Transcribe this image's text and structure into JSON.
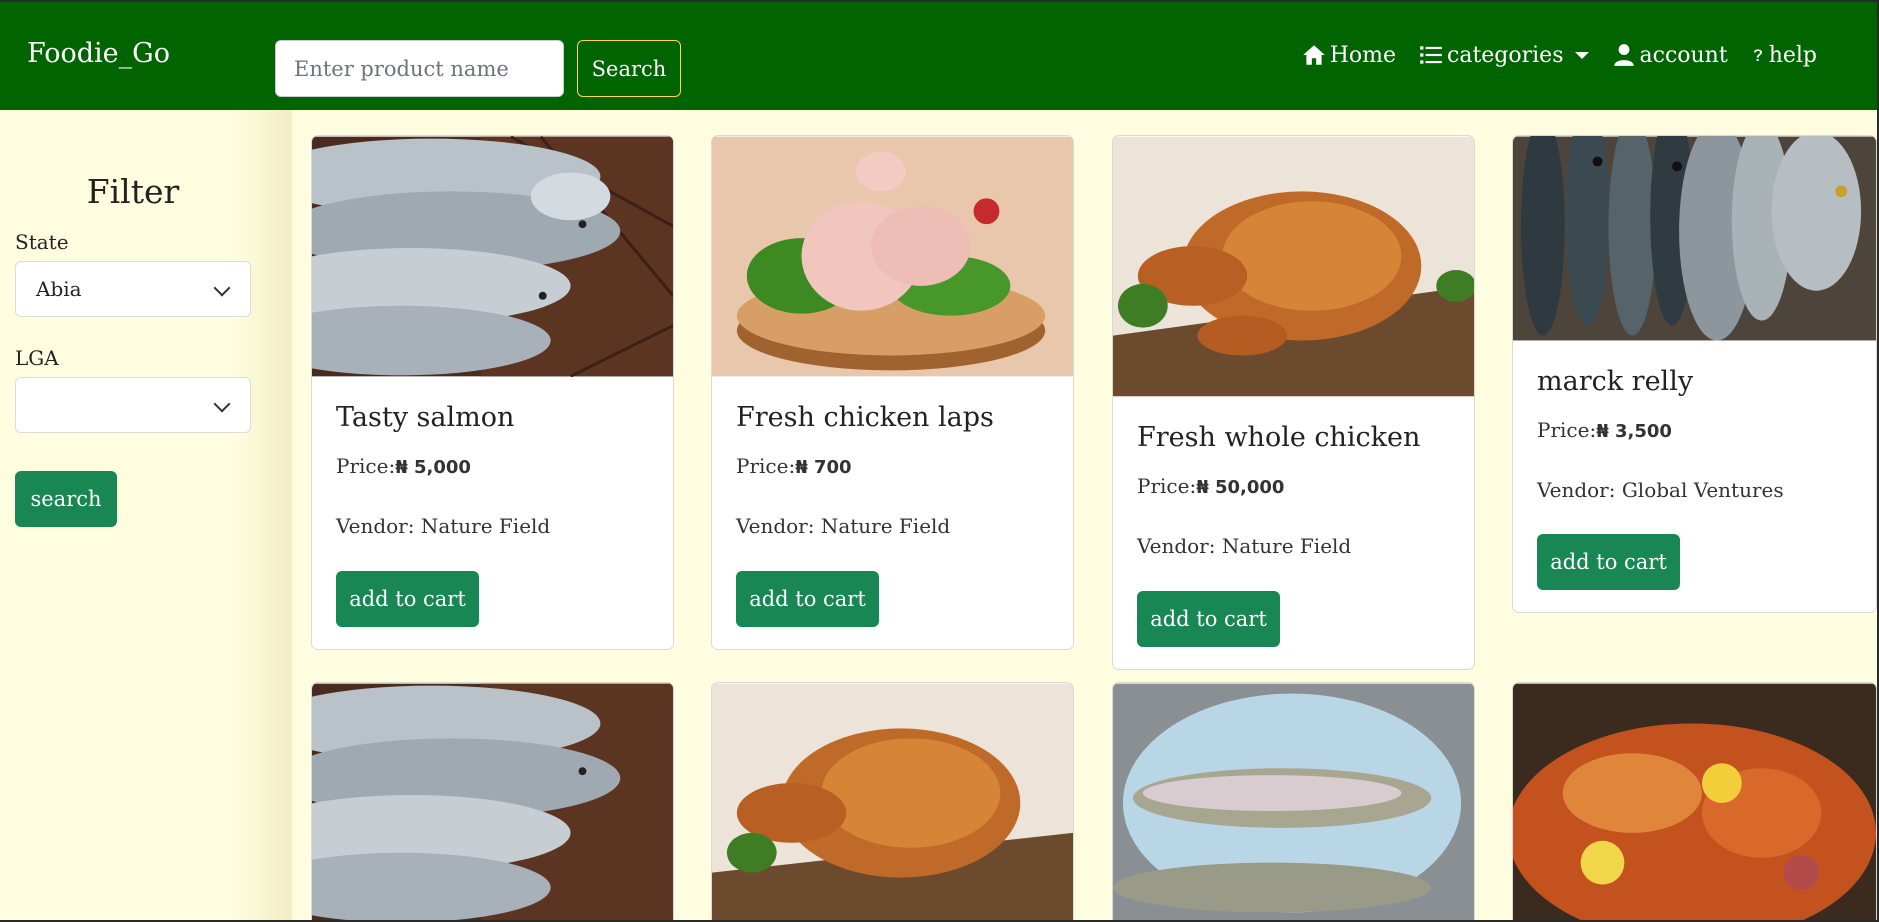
{
  "navbar": {
    "brand": "Foodie_Go",
    "search_placeholder": "Enter product name",
    "search_label": "Search",
    "links": {
      "home": "Home",
      "categories": "categories",
      "account": "account",
      "help": "help"
    }
  },
  "sidebar": {
    "title": "Filter",
    "state_label": "State",
    "state_value": "Abia",
    "lga_label": "LGA",
    "lga_value": "",
    "search_label": "search"
  },
  "currency": "₦",
  "products": [
    {
      "name": "Tasty salmon",
      "price_label": "Price:",
      "price": "₦ 5,000",
      "vendor": "Vendor: Nature Field",
      "button": "add to cart",
      "image": "salmon"
    },
    {
      "name": "Fresh chicken laps",
      "price_label": "Price:",
      "price": "₦ 700",
      "vendor": "Vendor: Nature Field",
      "button": "add to cart",
      "image": "raw-chicken-legs"
    },
    {
      "name": "Fresh whole chicken",
      "price_label": "Price:",
      "price": "₦ 50,000",
      "vendor": "Vendor: Nature Field",
      "button": "add to cart",
      "image": "roast-chicken"
    },
    {
      "name": "marck relly",
      "price_label": "Price:",
      "price": "₦ 3,500",
      "vendor": "Vendor: Global Ventures",
      "button": "add to cart",
      "image": "mackerel"
    }
  ],
  "second_row_images": [
    "salmon",
    "roast-chicken",
    "trout",
    "seafood-boil"
  ]
}
